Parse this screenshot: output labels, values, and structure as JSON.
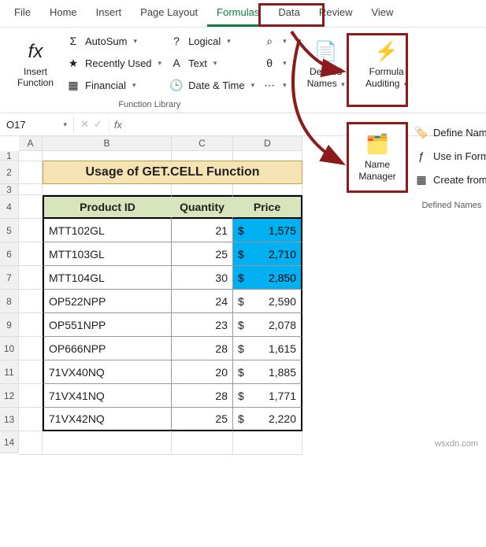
{
  "menu": [
    "File",
    "Home",
    "Insert",
    "Page Layout",
    "Formulas",
    "Data",
    "Review",
    "View"
  ],
  "menu_active": "Formulas",
  "ribbon": {
    "insert_fn": {
      "label": "Insert Function",
      "iconText": "fx"
    },
    "lib_a": [
      {
        "icon": "Σ",
        "text": "AutoSum"
      },
      {
        "icon": "★",
        "text": "Recently Used"
      },
      {
        "icon": "▦",
        "text": "Financial"
      }
    ],
    "lib_b": [
      {
        "icon": "?",
        "text": "Logical"
      },
      {
        "icon": "A",
        "text": "Text"
      },
      {
        "icon": "🕒",
        "text": "Date & Time"
      }
    ],
    "lib_c": [
      {
        "icon": "⌕"
      },
      {
        "icon": "θ"
      },
      {
        "icon": "⋯"
      }
    ],
    "group_label": "Function Library",
    "defined_names": {
      "label": "Defined",
      "label2": "Names"
    },
    "formula_auditing": {
      "label": "Formula",
      "label2": "Auditing"
    }
  },
  "namebox": "O17",
  "formula_bar": "",
  "cols": [
    "A",
    "B",
    "C",
    "D"
  ],
  "rows": [
    "1",
    "2",
    "3",
    "4",
    "5",
    "6",
    "7",
    "8",
    "9",
    "10",
    "11",
    "12",
    "13",
    "14"
  ],
  "title": "Usage of GET.CELL Function",
  "table": {
    "headers": [
      "Product ID",
      "Quantity",
      "Price"
    ],
    "rows": [
      {
        "pid": "MTT102GL",
        "qty": "21",
        "sym": "$",
        "price": "1,575",
        "hl": true
      },
      {
        "pid": "MTT103GL",
        "qty": "25",
        "sym": "$",
        "price": "2,710",
        "hl": true
      },
      {
        "pid": "MTT104GL",
        "qty": "30",
        "sym": "$",
        "price": "2,850",
        "hl": true
      },
      {
        "pid": "OP522NPP",
        "qty": "24",
        "sym": "$",
        "price": "2,590",
        "hl": false
      },
      {
        "pid": "OP551NPP",
        "qty": "23",
        "sym": "$",
        "price": "2,078",
        "hl": false
      },
      {
        "pid": "OP666NPP",
        "qty": "28",
        "sym": "$",
        "price": "1,615",
        "hl": false
      },
      {
        "pid": "71VX40NQ",
        "qty": "20",
        "sym": "$",
        "price": "1,885",
        "hl": false
      },
      {
        "pid": "71VX41NQ",
        "qty": "28",
        "sym": "$",
        "price": "1,771",
        "hl": false
      },
      {
        "pid": "71VX42NQ",
        "qty": "25",
        "sym": "$",
        "price": "2,220",
        "hl": false
      }
    ]
  },
  "popmenu": {
    "name_manager": {
      "label": "Name",
      "label2": "Manager"
    },
    "extras": [
      "Define Nam",
      "Use in Form",
      "Create from"
    ],
    "group_label": "Defined Names"
  },
  "watermark": "wsxdn.com"
}
